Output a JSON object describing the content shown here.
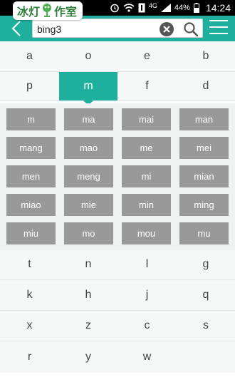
{
  "status_bar": {
    "brand": "冰灯作室",
    "brand_left": "冰灯",
    "brand_right": "作室",
    "network": "4G",
    "battery": "44%",
    "time": "14:24"
  },
  "search": {
    "value": "bing3"
  },
  "letters_top": [
    [
      "a",
      "o",
      "e",
      "b"
    ],
    [
      "p",
      "m",
      "f",
      "d"
    ]
  ],
  "active_letter": "m",
  "pinyin_options": [
    [
      "m",
      "ma",
      "mai",
      "man"
    ],
    [
      "mang",
      "mao",
      "me",
      "mei"
    ],
    [
      "men",
      "meng",
      "mi",
      "mian"
    ],
    [
      "miao",
      "mie",
      "min",
      "ming"
    ],
    [
      "miu",
      "mo",
      "mou",
      "mu"
    ]
  ],
  "letters_bottom": [
    [
      "t",
      "n",
      "l",
      "g"
    ],
    [
      "k",
      "h",
      "j",
      "q"
    ],
    [
      "x",
      "z",
      "c",
      "s"
    ],
    [
      "r",
      "y",
      "w",
      ""
    ]
  ],
  "colors": {
    "accent": "#1fb09d",
    "button_gray": "#999999"
  }
}
